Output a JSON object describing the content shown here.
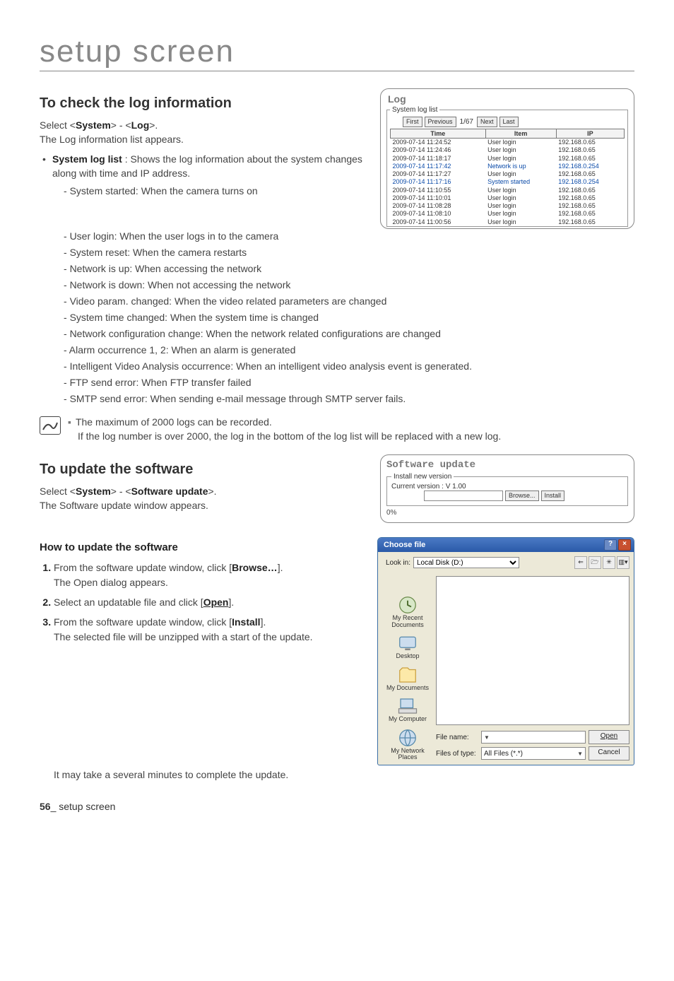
{
  "title": "setup screen",
  "footer": {
    "page": "56",
    "label": "_ setup screen"
  },
  "log_section": {
    "heading": "To check the log information",
    "instr_prefix": "Select <",
    "sys": "System",
    "sep": "> - <",
    "log": "Log",
    "instr_suffix": ">.",
    "list_appears": "The Log information list appears.",
    "bullet_label": "System log list",
    "bullet_desc": " : Shows the log information about the system changes along with time and IP address.",
    "items": [
      "System started: When the camera turns on",
      "User login: When the user logs in to the camera",
      "System reset: When the camera restarts",
      "Network is up: When accessing the network",
      "Network is down: When not accessing the network",
      "Video param. changed: When the video related parameters are changed",
      "System time changed: When the system time is changed",
      "Network configuration change: When the network related configurations are changed",
      "Alarm occurrence 1, 2: When an alarm is generated",
      "Intelligent Video Analysis occurrence: When an intelligent video analysis event is generated.",
      "FTP send error: When FTP transfer failed",
      "SMTP send error: When sending e-mail message through SMTP server fails."
    ],
    "note1": "The maximum of 2000 logs can be recorded.",
    "note2": "If the log number is over 2000, the log in the bottom of the log list will be replaced with a new log."
  },
  "log_panel": {
    "title": "Log",
    "legend": "System log list",
    "first": "First",
    "prev": "Previous",
    "page": "1/67",
    "next": "Next",
    "last": "Last",
    "th_time": "Time",
    "th_item": "Item",
    "th_ip": "IP",
    "rows": [
      {
        "t": "2009-07-14 11:24:52",
        "i": "User login",
        "ip": "192.168.0.65",
        "sys": false
      },
      {
        "t": "2009-07-14 11:24:46",
        "i": "User login",
        "ip": "192.168.0.65",
        "sys": false
      },
      {
        "t": "2009-07-14 11:18:17",
        "i": "User login",
        "ip": "192.168.0.65",
        "sys": false
      },
      {
        "t": "2009-07-14 11:17:42",
        "i": "Network is up",
        "ip": "192.168.0.254",
        "sys": true
      },
      {
        "t": "2009-07-14 11:17:27",
        "i": "User login",
        "ip": "192.168.0.65",
        "sys": false
      },
      {
        "t": "2009-07-14 11:17:16",
        "i": "System started",
        "ip": "192.168.0.254",
        "sys": true
      },
      {
        "t": "2009-07-14 11:10:55",
        "i": "User login",
        "ip": "192.168.0.65",
        "sys": false
      },
      {
        "t": "2009-07-14 11:10:01",
        "i": "User login",
        "ip": "192.168.0.65",
        "sys": false
      },
      {
        "t": "2009-07-14 11:08:28",
        "i": "User login",
        "ip": "192.168.0.65",
        "sys": false
      },
      {
        "t": "2009-07-14 11:08:10",
        "i": "User login",
        "ip": "192.168.0.65",
        "sys": false
      },
      {
        "t": "2009-07-14 11:00:56",
        "i": "User login",
        "ip": "192.168.0.65",
        "sys": false
      }
    ]
  },
  "sw_section": {
    "heading": "To update the software",
    "instr_prefix": "Select <",
    "sys": "System",
    "sep": "> - <",
    "sw": "Software update",
    "instr_suffix": ">.",
    "list_appears": "The Software update window appears."
  },
  "sw_panel": {
    "title": "Software update",
    "legend": "Install new version",
    "cur": "Current version : V 1.00",
    "browse": "Browse...",
    "install": "Install",
    "pct": "0%"
  },
  "howto": {
    "heading": "How to update the software",
    "s1a": "From the software update window, click [",
    "s1b": "Browse…",
    "s1c": "].",
    "s1d": "The Open dialog appears.",
    "s2a": "Select an updatable file and click [",
    "s2b": "Open",
    "s2c": "].",
    "s3a": "From the software update window, click [",
    "s3b": "Install",
    "s3c": "].",
    "s3d": "The selected file will be unzipped with a start of the update.",
    "s3e": "It may take a several minutes to complete the update."
  },
  "dialog": {
    "title": "Choose file",
    "lookin_lbl": "Look in:",
    "lookin_val": "Local Disk (D:)",
    "places": {
      "recent": "My Recent Documents",
      "desktop": "Desktop",
      "docs": "My Documents",
      "comp": "My Computer",
      "net": "My Network Places"
    },
    "fname_lbl": "File name:",
    "ftype_lbl": "Files of type:",
    "ftype_val": "All Files (*.*)",
    "open": "Open",
    "cancel": "Cancel"
  }
}
